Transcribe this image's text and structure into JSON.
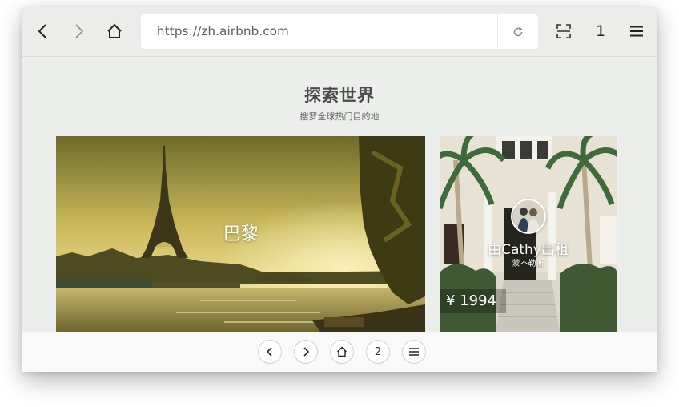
{
  "toolbar": {
    "icons": [
      "back-arrow-icon",
      "forward-arrow-icon",
      "home-icon",
      "reload-icon",
      "scan-icon",
      "menu-icon"
    ],
    "url": "https://zh.airbnb.com",
    "tab_count": "1"
  },
  "section": {
    "title": "探索世界",
    "subtitle": "搜罗全球热门目的地"
  },
  "cards": {
    "destination": {
      "label": "巴黎"
    },
    "listing": {
      "host_label": "由Cathy出租",
      "host_sub": "蒙不勒斯",
      "price": "¥ 1994"
    }
  },
  "bottombar": {
    "icons": [
      "back-arrow-icon",
      "forward-arrow-icon",
      "home-icon",
      "menu-icon"
    ],
    "tab_count": "2"
  }
}
